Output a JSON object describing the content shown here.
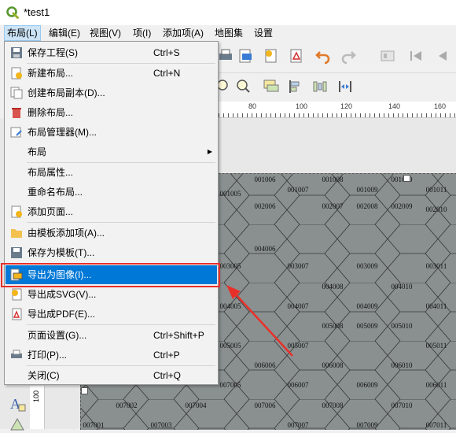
{
  "window": {
    "title": "*test1"
  },
  "menubar": [
    {
      "label": "布局(L)",
      "active": true
    },
    {
      "label": "编辑(E)"
    },
    {
      "label": "视图(V)"
    },
    {
      "label": "项(I)"
    },
    {
      "label": "添加项(A)"
    },
    {
      "label": "地图集"
    },
    {
      "label": "设置"
    }
  ],
  "menu": {
    "items": [
      {
        "label": "保存工程(S)",
        "shortcut": "Ctrl+S",
        "icon": "save-icon"
      },
      {
        "label": "新建布局...",
        "shortcut": "Ctrl+N",
        "icon": "new-layout-icon"
      },
      {
        "label": "创建布局副本(D)...",
        "icon": "duplicate-layout-icon"
      },
      {
        "label": "删除布局...",
        "icon": "trash-icon"
      },
      {
        "label": "布局管理器(M)...",
        "icon": "layout-manager-icon"
      },
      {
        "label": "布局",
        "submenu": true
      },
      {
        "label": "布局属性..."
      },
      {
        "label": "重命名布局..."
      },
      {
        "label": "添加页面...",
        "icon": "add-page-icon"
      },
      {
        "label": "由模板添加项(A)...",
        "icon": "folder-icon"
      },
      {
        "label": "保存为模板(T)...",
        "icon": "save-template-icon"
      },
      {
        "label": "导出为图像(I)...",
        "icon": "export-image-icon",
        "highlighted": true
      },
      {
        "label": "导出成SVG(V)...",
        "icon": "export-svg-icon"
      },
      {
        "label": "导出成PDF(E)...",
        "icon": "export-pdf-icon"
      },
      {
        "label": "页面设置(G)...",
        "shortcut": "Ctrl+Shift+P"
      },
      {
        "label": "打印(P)...",
        "shortcut": "Ctrl+P",
        "icon": "print-icon"
      },
      {
        "label": "关闭(C)",
        "shortcut": "Ctrl+Q"
      }
    ]
  },
  "ruler": {
    "labels": [
      "80",
      "100",
      "120",
      "140",
      "160"
    ]
  },
  "ruler_v": {
    "label": "100"
  },
  "map_cells": [
    "001005",
    "001006",
    "001007",
    "001008",
    "001009",
    "001010",
    "001011",
    "002006",
    "002007",
    "002008",
    "002009",
    "002010",
    "003005",
    "003007",
    "003009",
    "003011",
    "004006",
    "004008",
    "004010",
    "004005",
    "004007",
    "004009",
    "004011",
    "005008",
    "005009",
    "005010",
    "005005",
    "005007",
    "005011",
    "006006",
    "006008",
    "006010",
    "007005",
    "006007",
    "006009",
    "006011",
    "007002",
    "007004",
    "007006",
    "007008",
    "007010",
    "007001",
    "007003",
    "007007",
    "007009",
    "007011"
  ],
  "colors": {
    "highlight": "#0078d7",
    "annotation": "#e8302a",
    "map_fill": "#8a9090"
  }
}
